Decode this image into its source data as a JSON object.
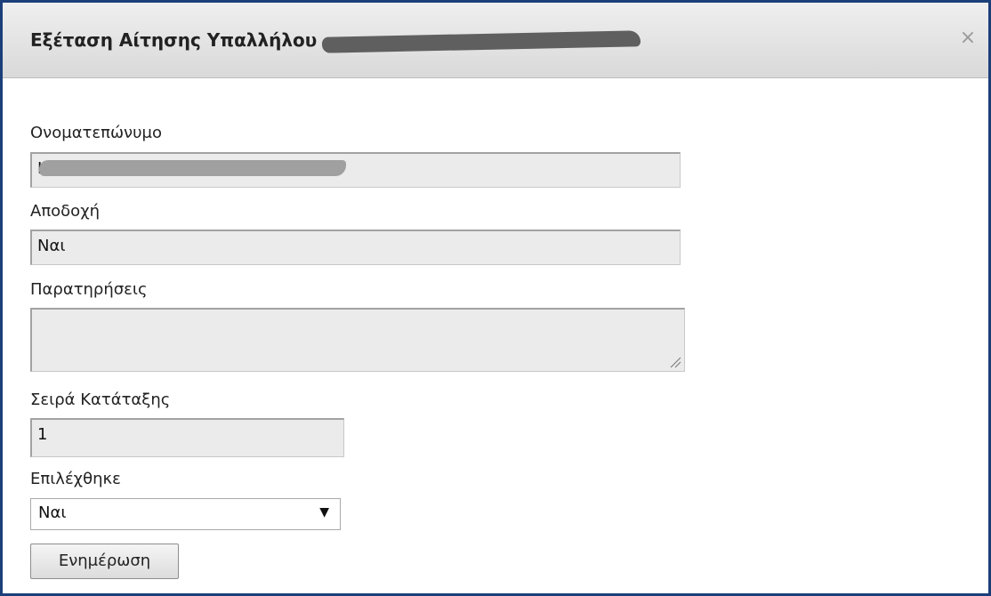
{
  "dialog": {
    "title": "Εξέταση Αίτησης Υπαλλήλου",
    "close_label": "×"
  },
  "form": {
    "name": {
      "label": "Ονοματεπώνυμο",
      "value": "Ι"
    },
    "acceptance": {
      "label": "Αποδοχή",
      "value": "Ναι"
    },
    "notes": {
      "label": "Παρατηρήσεις",
      "value": ""
    },
    "rank": {
      "label": "Σειρά Κατάταξης",
      "value": "1"
    },
    "selected": {
      "label": "Επιλέχθηκε",
      "value": "Ναι",
      "arrow": "▼"
    },
    "update_button": "Ενημέρωση"
  }
}
